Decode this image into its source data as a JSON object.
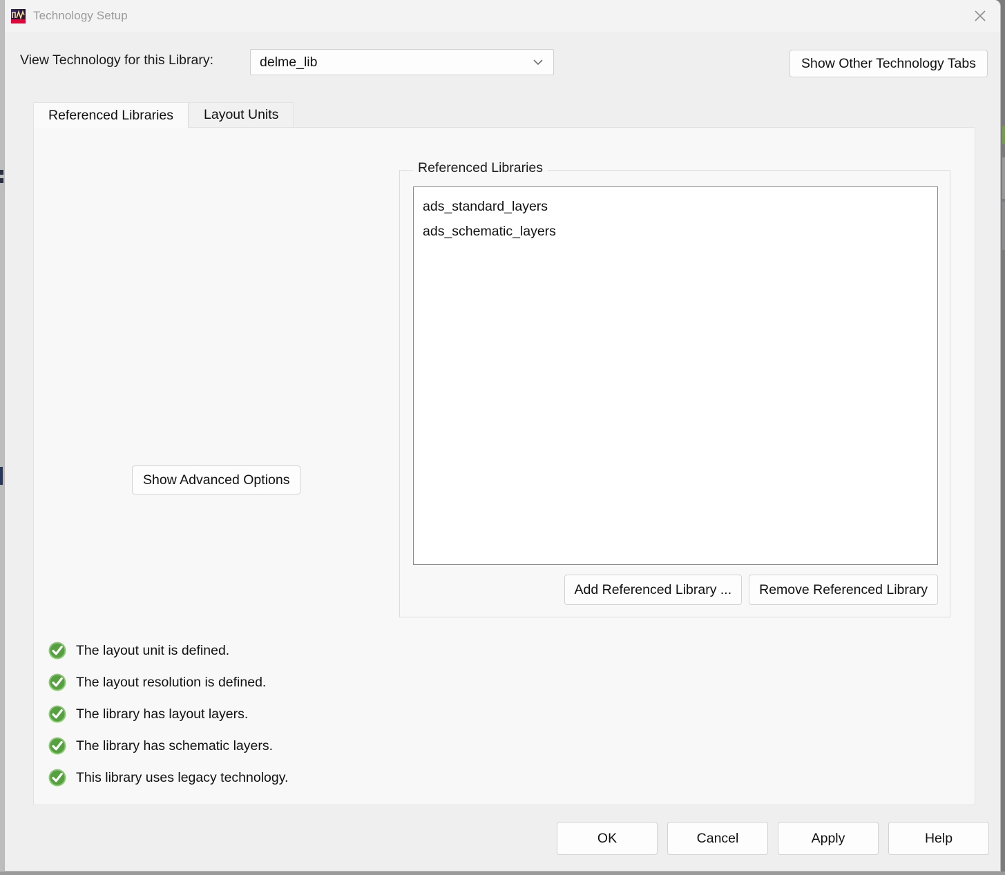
{
  "window": {
    "title": "Technology Setup",
    "icon": "waveform-app-icon",
    "close_icon": "close-icon"
  },
  "top_row": {
    "library_label": "View Technology for this Library:",
    "library_combo": {
      "value": "delme_lib",
      "arrow_icon": "chevron-down-icon"
    },
    "show_other_tabs_button": "Show Other Technology Tabs"
  },
  "tabs": [
    {
      "label": "Referenced Libraries",
      "selected": true
    },
    {
      "label": "Layout Units",
      "selected": false
    }
  ],
  "panel": {
    "show_advanced_button": "Show Advanced Options",
    "referenced_libraries_group": {
      "legend": "Referenced Libraries",
      "items": [
        "ads_standard_layers",
        "ads_schematic_layers"
      ],
      "add_button": "Add Referenced Library ...",
      "remove_button": "Remove Referenced Library"
    },
    "status_items": [
      {
        "icon": "green-check-icon",
        "text": "The layout unit is defined."
      },
      {
        "icon": "green-check-icon",
        "text": "The layout resolution is defined."
      },
      {
        "icon": "green-check-icon",
        "text": "The library has layout layers."
      },
      {
        "icon": "green-check-icon",
        "text": "The library has schematic layers."
      },
      {
        "icon": "green-check-icon",
        "text": "This library uses legacy technology."
      }
    ]
  },
  "footer": {
    "ok": "OK",
    "cancel": "Cancel",
    "apply": "Apply",
    "help": "Help"
  },
  "colors": {
    "dialog_bg": "#efefef",
    "panel_bg": "#f8f8f8",
    "titlebar_bg": "#f3f3f3",
    "title_text": "#9a9a9a",
    "status_ok": "#5aa845",
    "listbox_border": "#8a8a8a",
    "desktop": "#7b7b7b"
  }
}
